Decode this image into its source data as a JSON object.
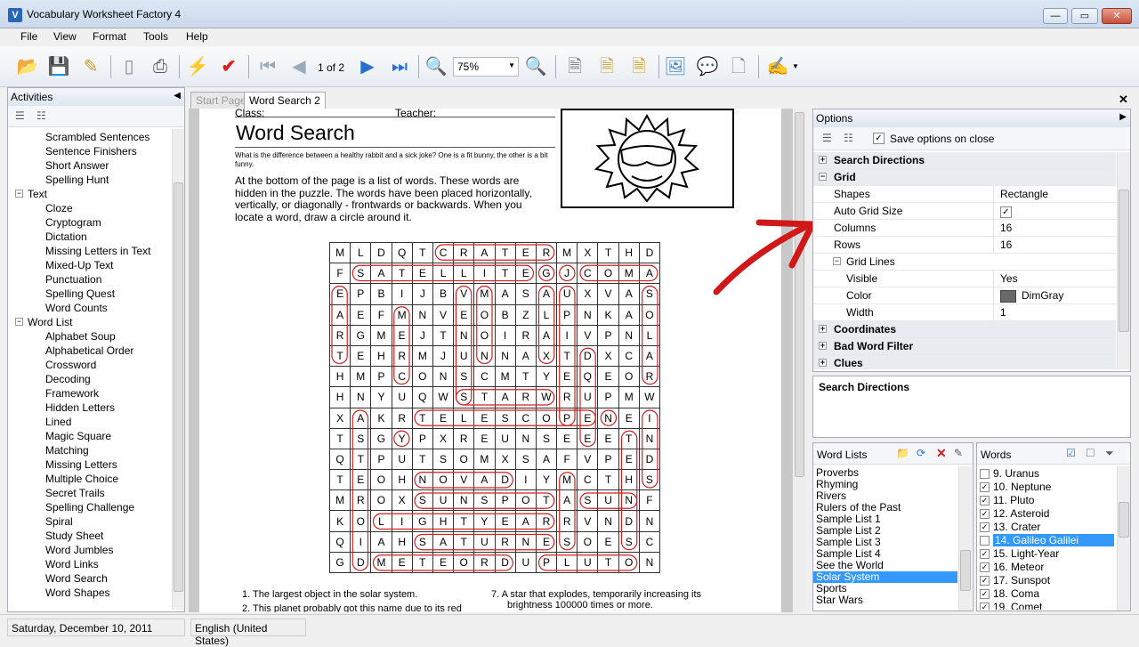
{
  "window": {
    "title": "Vocabulary Worksheet Factory 4",
    "min": "—",
    "max": "▭",
    "close": "✕"
  },
  "menu": [
    "File",
    "View",
    "Format",
    "Tools",
    "Help"
  ],
  "toolbar": {
    "page": "1 of 2",
    "zoom": "75%"
  },
  "activities": {
    "title": "Activities",
    "items": [
      {
        "label": "Scrambled Sentences",
        "level": 2
      },
      {
        "label": "Sentence Finishers",
        "level": 2
      },
      {
        "label": "Short Answer",
        "level": 2
      },
      {
        "label": "Spelling Hunt",
        "level": 2
      },
      {
        "label": "Text",
        "level": 1
      },
      {
        "label": "Cloze",
        "level": 2
      },
      {
        "label": "Cryptogram",
        "level": 2
      },
      {
        "label": "Dictation",
        "level": 2
      },
      {
        "label": "Missing Letters in Text",
        "level": 2
      },
      {
        "label": "Mixed-Up Text",
        "level": 2
      },
      {
        "label": "Punctuation",
        "level": 2
      },
      {
        "label": "Spelling Quest",
        "level": 2
      },
      {
        "label": "Word Counts",
        "level": 2
      },
      {
        "label": "Word List",
        "level": 1
      },
      {
        "label": "Alphabet Soup",
        "level": 2
      },
      {
        "label": "Alphabetical Order",
        "level": 2
      },
      {
        "label": "Crossword",
        "level": 2
      },
      {
        "label": "Decoding",
        "level": 2
      },
      {
        "label": "Framework",
        "level": 2
      },
      {
        "label": "Hidden Letters",
        "level": 2
      },
      {
        "label": "Lined",
        "level": 2
      },
      {
        "label": "Magic Square",
        "level": 2
      },
      {
        "label": "Matching",
        "level": 2
      },
      {
        "label": "Missing Letters",
        "level": 2
      },
      {
        "label": "Multiple Choice",
        "level": 2
      },
      {
        "label": "Secret Trails",
        "level": 2
      },
      {
        "label": "Spelling Challenge",
        "level": 2
      },
      {
        "label": "Spiral",
        "level": 2
      },
      {
        "label": "Study Sheet",
        "level": 2
      },
      {
        "label": "Word Jumbles",
        "level": 2
      },
      {
        "label": "Word Links",
        "level": 2
      },
      {
        "label": "Word Search",
        "level": 2
      },
      {
        "label": "Word Shapes",
        "level": 2
      }
    ]
  },
  "tabs": [
    "Start Page",
    "Word Search 2"
  ],
  "worksheet": {
    "class_label": "Class:",
    "teacher_label": "Teacher:",
    "title": "Word Search",
    "joke": "What is the difference between a healthy rabbit and a sick joke? One is a fit bunny, the other is a bit funny.",
    "instructions": "At the bottom of the page is a list of words. These words are hidden in the puzzle. The words have been placed horizontally, vertically, or diagonally - frontwards or backwards. When you locate a word, draw a circle around it.",
    "grid": [
      "MLDQTCRATERMXTHD",
      "FSATELLITEGJCOMA",
      "EPBIJBVMASAUXVAS",
      "AEFMNVEOBZLPNKAO",
      "RGMEJTNOIRAIVPNL",
      "TEHRMJUNNAXTDXCA",
      "HMPCONSCMTYEQEOR",
      "HNYUQWSTARWRUPMW",
      "XAKRTELESCOPENEI",
      "TSGYPXREUNSEEETN",
      "QTPUTSOMXSAFVPED",
      "TEOHNOVADIYMCTHS",
      "MROXSUNSPOTASUNF",
      "KOLIGHTYEARRVNDN",
      "QIAHSATURNESOESC",
      "GDMETEORDUPLUTON"
    ],
    "clues": [
      "1.  The largest object in the solar system.",
      "2.  This planet probably got this name due to its red",
      "7.  A star that explodes, temporarily increasing its",
      "brightness 100000 times or more."
    ]
  },
  "options": {
    "title": "Options",
    "save_label": "Save options on close",
    "rows": [
      {
        "k": "Search Directions",
        "type": "cat",
        "sign": "+"
      },
      {
        "k": "Grid",
        "type": "cat",
        "sign": "−"
      },
      {
        "k": "Shapes",
        "v": "Rectangle"
      },
      {
        "k": "Auto Grid Size",
        "v": "✓",
        "check": true
      },
      {
        "k": "Columns",
        "v": "16"
      },
      {
        "k": "Rows",
        "v": "16"
      },
      {
        "k": "Grid Lines",
        "type": "sub",
        "sign": "−"
      },
      {
        "k": "Visible",
        "v": "Yes",
        "indent": true
      },
      {
        "k": "Color",
        "v": "DimGray",
        "indent": true,
        "swatch": "#696969"
      },
      {
        "k": "Width",
        "v": "1",
        "indent": true
      },
      {
        "k": "Coordinates",
        "type": "cat",
        "sign": "+"
      },
      {
        "k": "Bad Word Filter",
        "type": "cat",
        "sign": "+"
      },
      {
        "k": "Clues",
        "type": "cat",
        "sign": "+"
      }
    ],
    "description_title": "Search Directions"
  },
  "word_lists": {
    "title": "Word Lists",
    "items": [
      "Proverbs",
      "Rhyming",
      "Rivers",
      "Rulers of the Past",
      "Sample List 1",
      "Sample List 2",
      "Sample List 3",
      "Sample List 4",
      "See the World",
      "Solar System",
      "Sports",
      "Star Wars"
    ],
    "selected": "Solar System"
  },
  "words": {
    "title": "Words",
    "items": [
      {
        "label": "9. Uranus",
        "checked": false
      },
      {
        "label": "10. Neptune",
        "checked": true
      },
      {
        "label": "11. Pluto",
        "checked": true
      },
      {
        "label": "12. Asteroid",
        "checked": true
      },
      {
        "label": "13. Crater",
        "checked": true
      },
      {
        "label": "14. Galileo Galilei",
        "checked": false,
        "selected": true
      },
      {
        "label": "15. Light-Year",
        "checked": true
      },
      {
        "label": "16. Meteor",
        "checked": true
      },
      {
        "label": "17. Sunspot",
        "checked": true
      },
      {
        "label": "18. Coma",
        "checked": true
      },
      {
        "label": "19. Comet",
        "checked": true
      }
    ]
  },
  "status": {
    "date": "Saturday, December 10, 2011",
    "language": "English (United States)"
  },
  "colors": {
    "accent": "#3399ff",
    "circle": "#d02020",
    "arrow": "#d01818"
  }
}
